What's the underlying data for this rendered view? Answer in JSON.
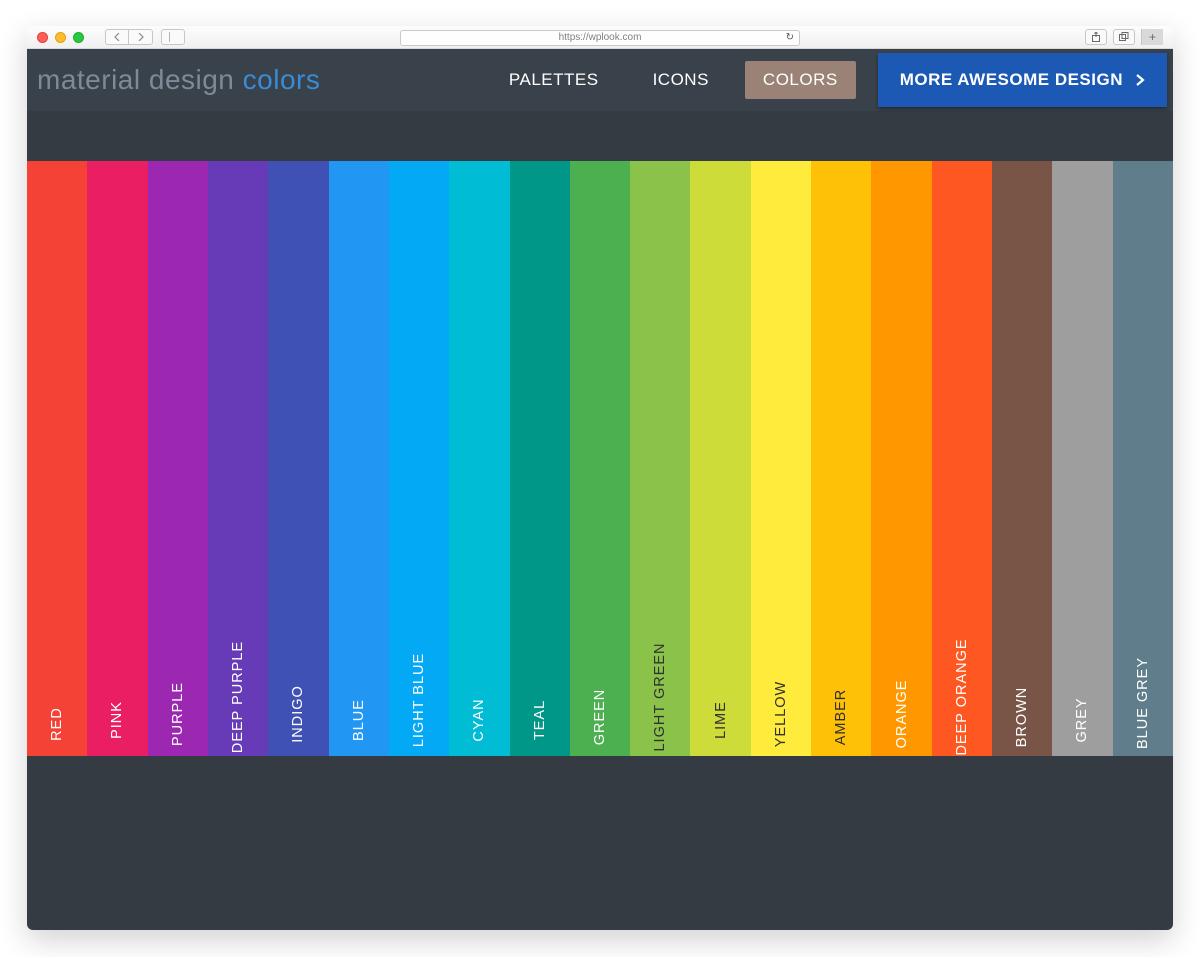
{
  "browser": {
    "url": "https://wplook.com"
  },
  "header": {
    "brand_prefix": "material design ",
    "brand_suffix": "colors",
    "nav": {
      "palettes": "PALETTES",
      "icons": "ICONS",
      "colors": "COLORS"
    },
    "cta_label": "MORE AWESOME DESIGN"
  },
  "swatches": [
    {
      "name": "RED",
      "hex": "#f44336",
      "dark": false
    },
    {
      "name": "PINK",
      "hex": "#e91e63",
      "dark": false
    },
    {
      "name": "PURPLE",
      "hex": "#9c27b0",
      "dark": false
    },
    {
      "name": "DEEP PURPLE",
      "hex": "#673ab7",
      "dark": false
    },
    {
      "name": "INDIGO",
      "hex": "#3f51b5",
      "dark": false
    },
    {
      "name": "BLUE",
      "hex": "#2196f3",
      "dark": false
    },
    {
      "name": "LIGHT BLUE",
      "hex": "#03a9f4",
      "dark": false
    },
    {
      "name": "CYAN",
      "hex": "#00bcd4",
      "dark": false
    },
    {
      "name": "TEAL",
      "hex": "#009688",
      "dark": false
    },
    {
      "name": "GREEN",
      "hex": "#4caf50",
      "dark": false
    },
    {
      "name": "LIGHT GREEN",
      "hex": "#8bc34a",
      "dark": true
    },
    {
      "name": "LIME",
      "hex": "#cddc39",
      "dark": true
    },
    {
      "name": "YELLOW",
      "hex": "#ffeb3b",
      "dark": true
    },
    {
      "name": "AMBER",
      "hex": "#ffc107",
      "dark": true
    },
    {
      "name": "ORANGE",
      "hex": "#ff9800",
      "dark": false
    },
    {
      "name": "DEEP ORANGE",
      "hex": "#ff5722",
      "dark": false
    },
    {
      "name": "BROWN",
      "hex": "#795548",
      "dark": false
    },
    {
      "name": "GREY",
      "hex": "#9e9e9e",
      "dark": false
    },
    {
      "name": "BLUE GREY",
      "hex": "#607d8b",
      "dark": false
    }
  ]
}
